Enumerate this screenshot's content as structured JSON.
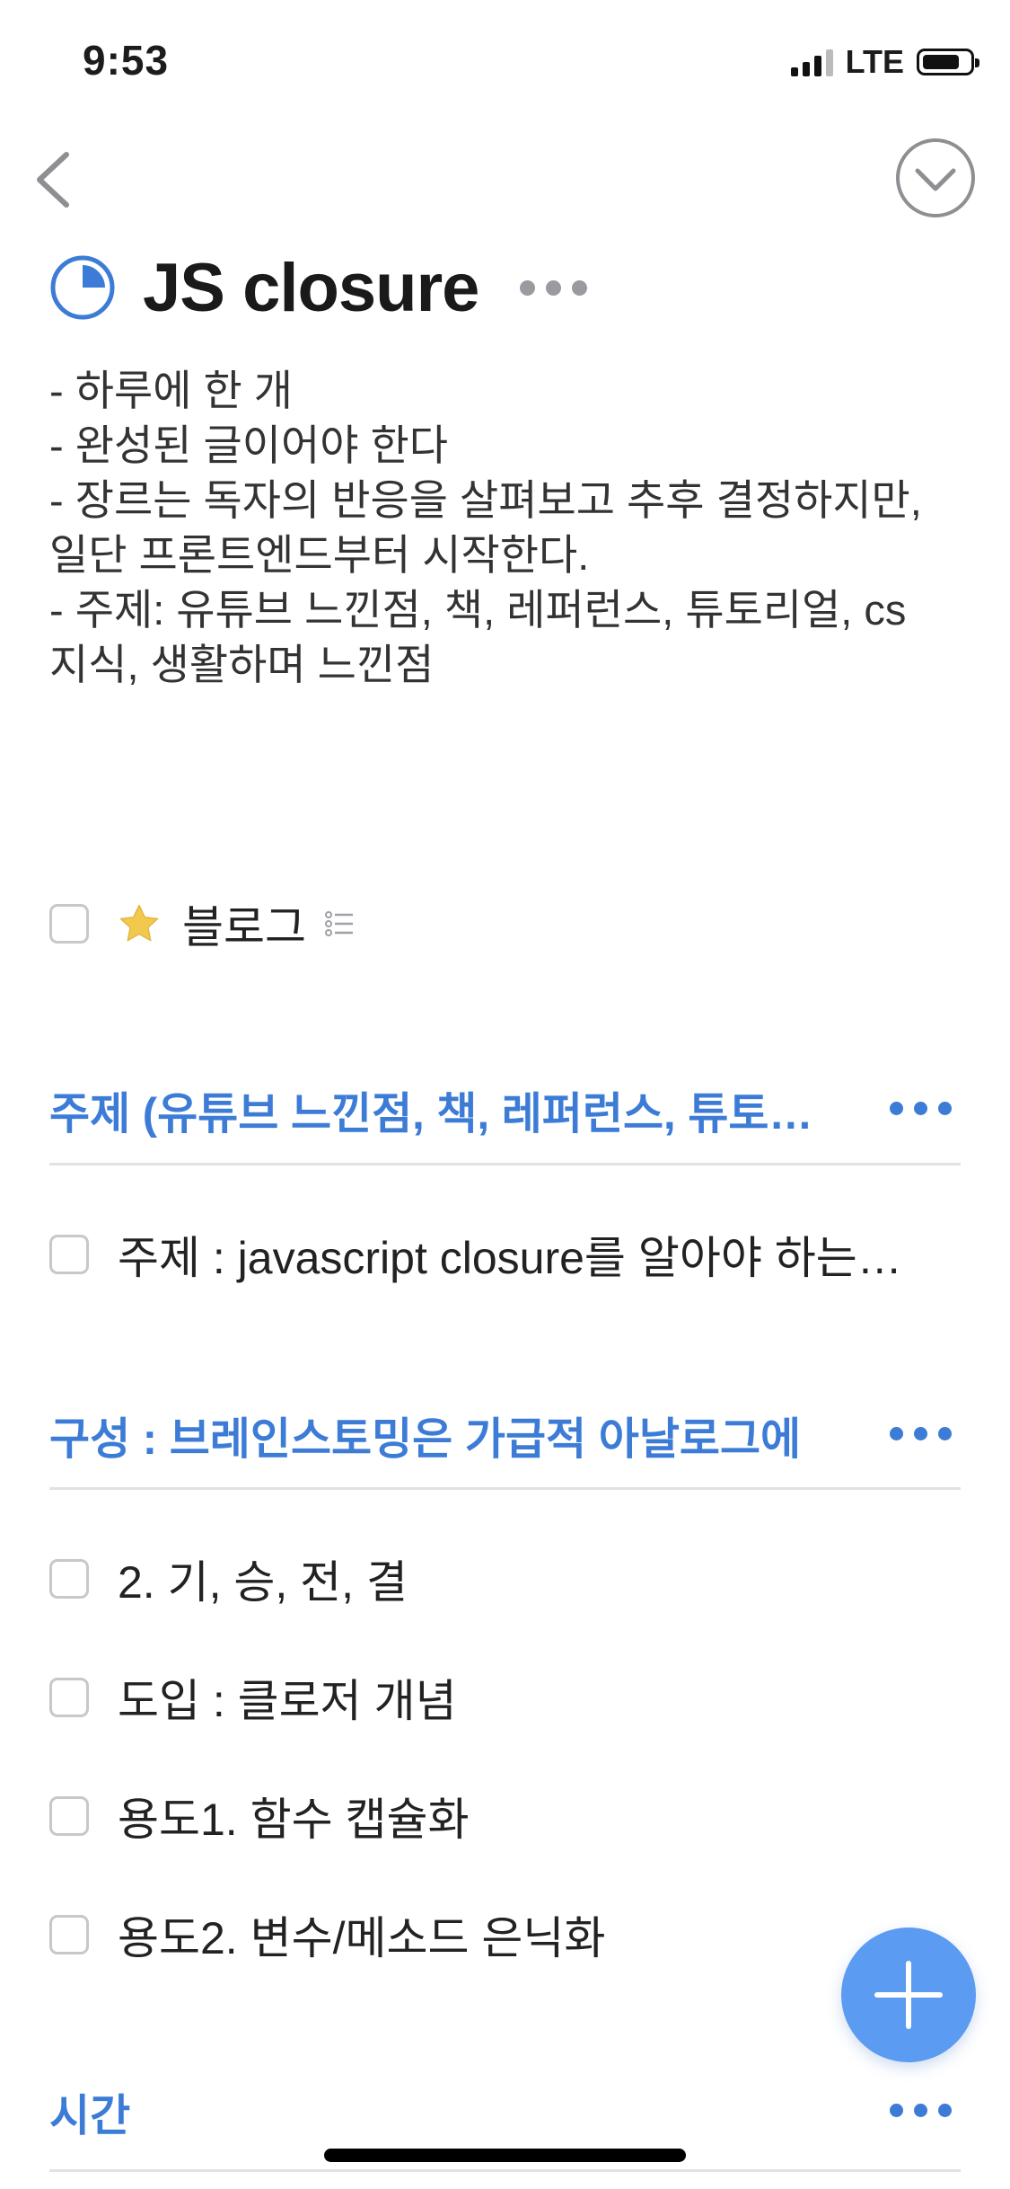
{
  "status_bar": {
    "time": "9:53",
    "network": "LTE"
  },
  "header": {
    "back_icon": "chevron-left-icon",
    "collapse_icon": "chevron-down-circle-icon"
  },
  "project": {
    "title": "JS closure",
    "progress_fraction": 0.25,
    "accent_color": "#3d7cd6",
    "notes": [
      "- 하루에 한 개",
      "- 완성된 글이어야 한다",
      "- 장르는 독자의 반응을 살펴보고 추후 결정하지만,",
      "일단 프론트엔드부터 시작한다.",
      "- 주제: 유튜브 느낀점, 책, 레퍼런스, 튜토리얼, cs",
      "지식, 생활하며 느낀점"
    ]
  },
  "tags_row": {
    "label": "블로그",
    "star_icon": "star-icon",
    "list_icon": "checklist-icon"
  },
  "sections": [
    {
      "title": "주제 (유튜브 느낀점, 책, 레퍼런스, 튜토…",
      "tasks": [
        "주제 :  javascript closure를 알아야 하는…"
      ]
    },
    {
      "title": "구성 : 브레인스토밍은 가급적 아날로그에",
      "tasks": [
        "2. 기, 승, 전, 결",
        "도입 : 클로저 개념",
        "용도1. 함수 캡슐화",
        "용도2. 변수/메소드 은닉화"
      ]
    },
    {
      "title": "시간",
      "tasks": []
    }
  ],
  "fab": {
    "icon": "plus-icon",
    "color": "#5b9bf1"
  }
}
